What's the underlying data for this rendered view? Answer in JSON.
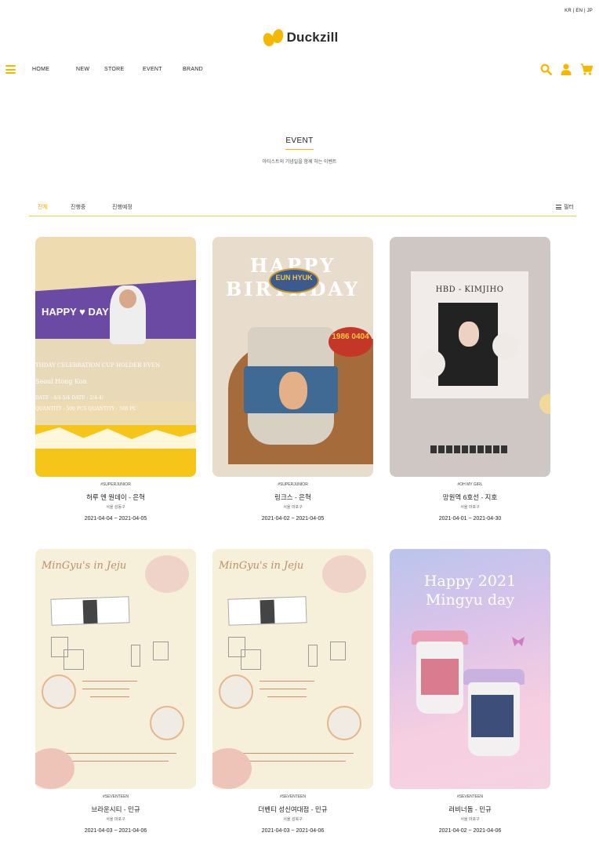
{
  "lang": "KR | EN | JP",
  "logo": {
    "text": "Duckzill"
  },
  "nav": {
    "items": [
      "HOME",
      "NEW",
      "STORE",
      "EVENT",
      "BRAND"
    ],
    "icons": [
      "menu-icon",
      "search-icon",
      "user-icon",
      "cart-icon"
    ]
  },
  "page": {
    "title": "EVENT",
    "subtitle": "아티스트의 기념일을 함께 하는 이벤트"
  },
  "tabs": {
    "items": [
      "전체",
      "진행중",
      "진행예정"
    ],
    "active": 0,
    "filter": "필터"
  },
  "thumbs": {
    "t1": {
      "hb": "HAPPY ♥ DAY",
      "line1": "THDAY CELEBRATION CUP HOLDER EVEN",
      "line2": "Seoul           Hong Kon",
      "line3": "DATE : 4/4-5/4      DATE : 2/4-4/",
      "line4": "QUANTITY : 500 PCS   QUANTITY : 500 PC"
    },
    "t2": {
      "happy": "HAPPY",
      "birthday": "BIRTHDAY",
      "pill": "EUN HYUK",
      "date": "1986 0404"
    },
    "t3": {
      "title": "HBD - KIMJIHO"
    },
    "t4": {
      "script": "MinGyu's in Jeju"
    },
    "t6": {
      "title1": "Happy 2021",
      "title2": "Mingyu day"
    }
  },
  "events": [
    {
      "tag": "#SUPERJUNIOR",
      "name": "허루 엔 원데이 - 은혁",
      "location": "서울 성동구",
      "date": "2021-04-04 ~ 2021-04-05"
    },
    {
      "tag": "#SUPERJUNIOR",
      "name": "링크스 - 은혁",
      "location": "서울 마포구",
      "date": "2021-04-02 ~ 2021-04-05"
    },
    {
      "tag": "#OH MY GIRL",
      "name": "망원역 6호선 - 지호",
      "location": "서울 마포구",
      "date": "2021-04-01 ~ 2021-04-30"
    },
    {
      "tag": "#SEVENTEEN",
      "name": "브라운시티 - 민규",
      "location": "서울 마포구",
      "date": "2021-04-03 ~ 2021-04-06"
    },
    {
      "tag": "#SEVENTEEN",
      "name": "더벤티 성신여대점 - 민규",
      "location": "서울 성북구",
      "date": "2021-04-03 ~ 2021-04-06"
    },
    {
      "tag": "#SEVENTEEN",
      "name": "러비너돔 - 민규",
      "location": "서울 마포구",
      "date": "2021-04-02 ~ 2021-04-06"
    }
  ],
  "colors": {
    "accent": "#f5b800",
    "tab_active": "#f5a800"
  }
}
